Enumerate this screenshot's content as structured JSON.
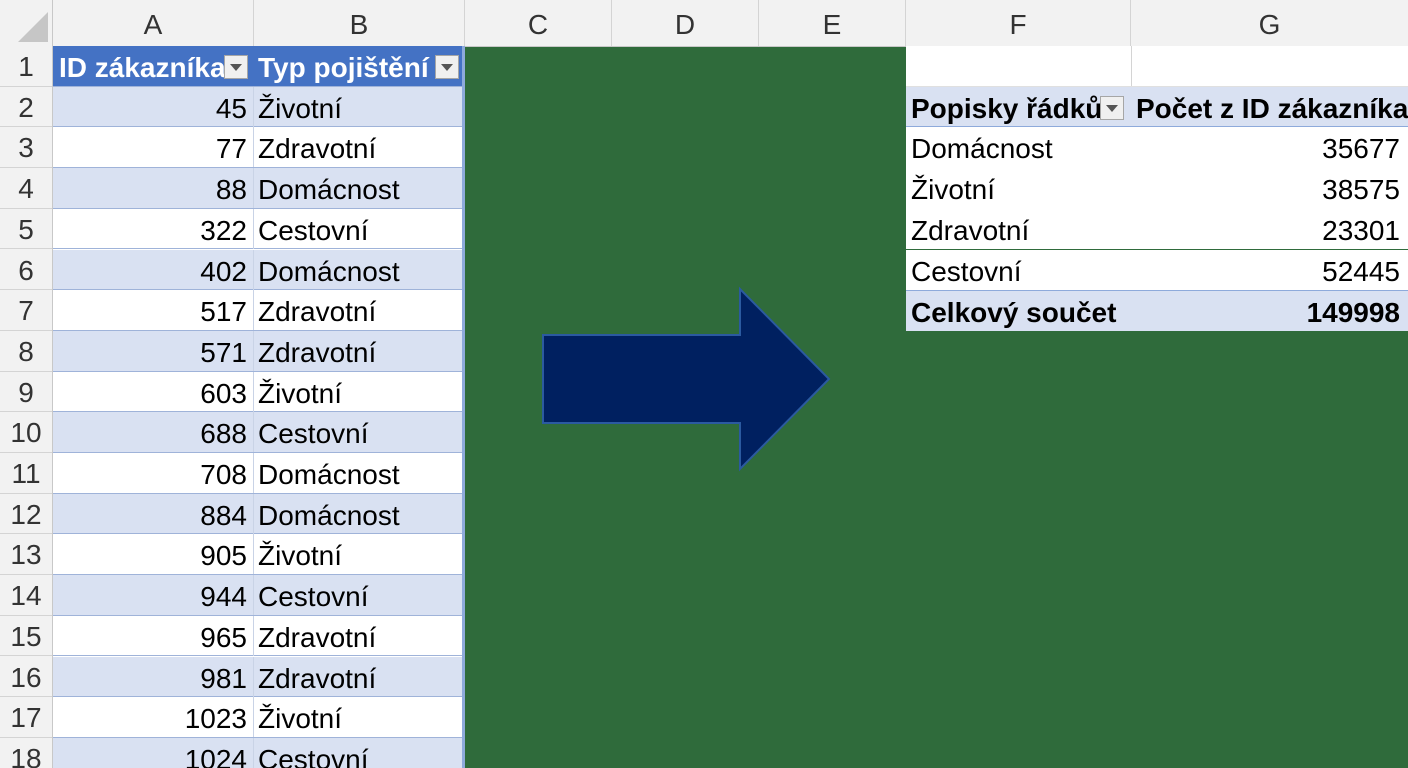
{
  "columns": [
    "A",
    "B",
    "C",
    "D",
    "E",
    "F",
    "G"
  ],
  "rows": [
    "1",
    "2",
    "3",
    "4",
    "5",
    "6",
    "7",
    "8",
    "9",
    "10",
    "11",
    "12",
    "13",
    "14",
    "15",
    "16",
    "17",
    "18"
  ],
  "table": {
    "headers": [
      "ID zákazníka",
      "Typ pojištění"
    ],
    "rows": [
      [
        "45",
        "Životní"
      ],
      [
        "77",
        "Zdravotní"
      ],
      [
        "88",
        "Domácnost"
      ],
      [
        "322",
        "Cestovní"
      ],
      [
        "402",
        "Domácnost"
      ],
      [
        "517",
        "Zdravotní"
      ],
      [
        "571",
        "Zdravotní"
      ],
      [
        "603",
        "Životní"
      ],
      [
        "688",
        "Cestovní"
      ],
      [
        "708",
        "Domácnost"
      ],
      [
        "884",
        "Domácnost"
      ],
      [
        "905",
        "Životní"
      ],
      [
        "944",
        "Cestovní"
      ],
      [
        "965",
        "Zdravotní"
      ],
      [
        "981",
        "Zdravotní"
      ],
      [
        "1023",
        "Životní"
      ],
      [
        "1024",
        "Cestovní"
      ]
    ]
  },
  "pivot": {
    "headers": [
      "Popisky řádků",
      "Počet z ID zákazníka"
    ],
    "rows": [
      [
        "Domácnost",
        "35677"
      ],
      [
        "Životní",
        "38575"
      ],
      [
        "Zdravotní",
        "23301"
      ],
      [
        "Cestovní",
        "52445"
      ]
    ],
    "total": [
      "Celkový součet",
      "149998"
    ]
  },
  "colors": {
    "table_header": "#4472c4",
    "band": "#d9e1f2",
    "background_green": "#2f6b3b",
    "arrow": "#002060"
  },
  "icons": [
    "filter-dropdown-icon",
    "right-arrow-shape"
  ]
}
